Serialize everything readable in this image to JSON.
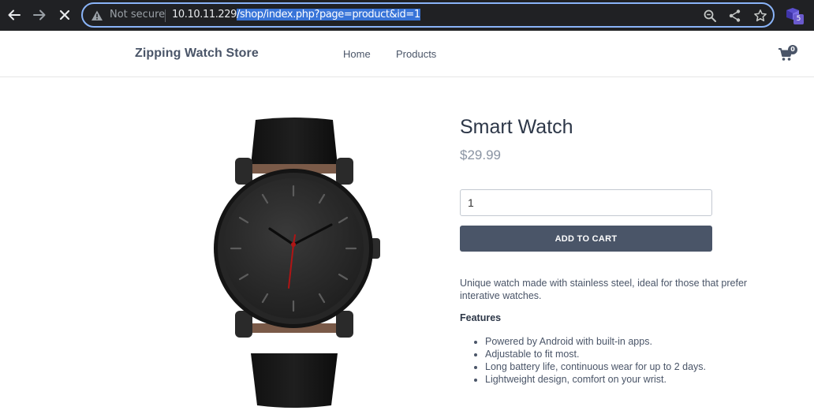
{
  "browser": {
    "security_label": "Not secure",
    "url_host": "10.10.11.229",
    "url_path": "/shop/index.php?page=product&id=1",
    "extension_badge": "5",
    "accent_color": "#8ab4f8"
  },
  "header": {
    "brand": "Zipping Watch Store",
    "nav": [
      "Home",
      "Products"
    ],
    "cart_count": "0"
  },
  "product": {
    "title": "Smart Watch",
    "price": "$29.99",
    "quantity": "1",
    "add_to_cart": "ADD TO CART",
    "description": "Unique watch made with stainless steel, ideal for those that prefer interative watches.",
    "features_title": "Features",
    "features": [
      "Powered by Android with built-in apps.",
      "Adjustable to fit most.",
      "Long battery life, continuous wear for up to 2 days.",
      "Lightweight design, comfort on your wrist."
    ]
  },
  "icons": {
    "back": "arrow-left-icon",
    "forward": "arrow-right-icon",
    "stop": "close-icon",
    "warning": "warning-triangle-icon",
    "zoom": "magnifier-icon",
    "share": "share-icon",
    "bookmark": "star-icon",
    "cart": "shopping-cart-icon"
  }
}
